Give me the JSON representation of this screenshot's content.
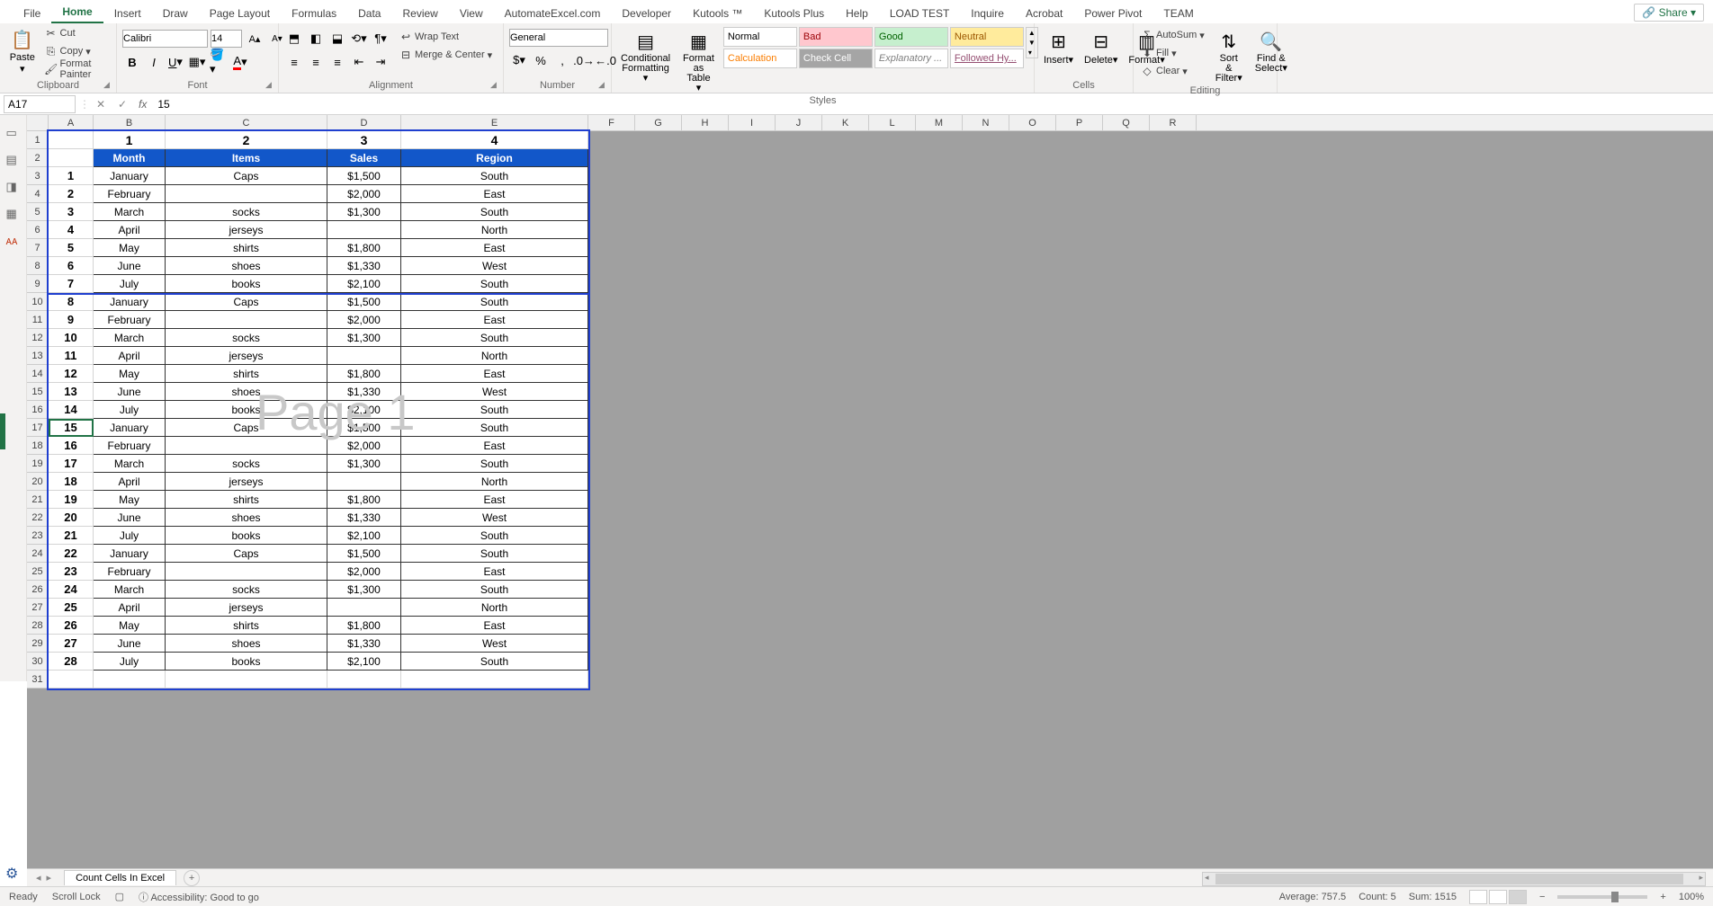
{
  "tabs": [
    "File",
    "Home",
    "Insert",
    "Draw",
    "Page Layout",
    "Formulas",
    "Data",
    "Review",
    "View",
    "AutomateExcel.com",
    "Developer",
    "Kutools ™",
    "Kutools Plus",
    "Help",
    "LOAD TEST",
    "Inquire",
    "Acrobat",
    "Power Pivot",
    "TEAM"
  ],
  "active_tab": "Home",
  "share": "Share",
  "clipboard": {
    "paste": "Paste",
    "cut": "Cut",
    "copy": "Copy",
    "painter": "Format Painter",
    "label": "Clipboard"
  },
  "font": {
    "name": "Calibri",
    "size": "14",
    "label": "Font"
  },
  "alignment": {
    "wrap": "Wrap Text",
    "merge": "Merge & Center",
    "label": "Alignment"
  },
  "number": {
    "format": "General",
    "label": "Number"
  },
  "styles": {
    "cond": "Conditional Formatting",
    "table": "Format as Table",
    "gallery": [
      {
        "t": "Normal",
        "bg": "#ffffff",
        "c": "#000"
      },
      {
        "t": "Bad",
        "bg": "#ffc7ce",
        "c": "#9c0006"
      },
      {
        "t": "Good",
        "bg": "#c6efce",
        "c": "#006100"
      },
      {
        "t": "Neutral",
        "bg": "#ffeb9c",
        "c": "#9c5700"
      },
      {
        "t": "Calculation",
        "bg": "#ffffff",
        "c": "#fa7d00"
      },
      {
        "t": "Check Cell",
        "bg": "#a5a5a5",
        "c": "#ffffff"
      },
      {
        "t": "Explanatory ...",
        "bg": "#ffffff",
        "c": "#7f7f7f",
        "i": true
      },
      {
        "t": "Followed Hy...",
        "bg": "#ffffff",
        "c": "#954f72",
        "u": true
      }
    ],
    "label": "Styles"
  },
  "cells_group": {
    "insert": "Insert",
    "delete": "Delete",
    "format": "Format",
    "label": "Cells"
  },
  "editing": {
    "autosum": "AutoSum",
    "fill": "Fill",
    "clear": "Clear",
    "sort": "Sort & Filter",
    "find": "Find & Select",
    "label": "Editing"
  },
  "name_box": "A17",
  "formula": "15",
  "columns": [
    "A",
    "B",
    "C",
    "D",
    "E",
    "F",
    "G",
    "H",
    "I",
    "J",
    "K",
    "L",
    "M",
    "N",
    "O",
    "P",
    "Q",
    "R"
  ],
  "col_widths": {
    "A": 50,
    "B": 80,
    "C": 180,
    "D": 82,
    "E": 208,
    "other": 52
  },
  "header_nums": [
    "1",
    "2",
    "3",
    "4"
  ],
  "table_headers": [
    "Month",
    "Items",
    "Sales",
    "Region"
  ],
  "rows": [
    {
      "n": "1",
      "m": "January",
      "i": "Caps",
      "s": "$1,500",
      "r": "South"
    },
    {
      "n": "2",
      "m": "February",
      "i": "",
      "s": "$2,000",
      "r": "East"
    },
    {
      "n": "3",
      "m": "March",
      "i": "socks",
      "s": "$1,300",
      "r": "South"
    },
    {
      "n": "4",
      "m": "April",
      "i": "jerseys",
      "s": "",
      "r": "North"
    },
    {
      "n": "5",
      "m": "May",
      "i": "shirts",
      "s": "$1,800",
      "r": "East"
    },
    {
      "n": "6",
      "m": "June",
      "i": "shoes",
      "s": "$1,330",
      "r": "West"
    },
    {
      "n": "7",
      "m": "July",
      "i": "books",
      "s": "$2,100",
      "r": "South"
    },
    {
      "n": "8",
      "m": "January",
      "i": "Caps",
      "s": "$1,500",
      "r": "South"
    },
    {
      "n": "9",
      "m": "February",
      "i": "",
      "s": "$2,000",
      "r": "East"
    },
    {
      "n": "10",
      "m": "March",
      "i": "socks",
      "s": "$1,300",
      "r": "South"
    },
    {
      "n": "11",
      "m": "April",
      "i": "jerseys",
      "s": "",
      "r": "North"
    },
    {
      "n": "12",
      "m": "May",
      "i": "shirts",
      "s": "$1,800",
      "r": "East"
    },
    {
      "n": "13",
      "m": "June",
      "i": "shoes",
      "s": "$1,330",
      "r": "West"
    },
    {
      "n": "14",
      "m": "July",
      "i": "books",
      "s": "$2,100",
      "r": "South"
    },
    {
      "n": "15",
      "m": "January",
      "i": "Caps",
      "s": "$1,500",
      "r": "South"
    },
    {
      "n": "16",
      "m": "February",
      "i": "",
      "s": "$2,000",
      "r": "East"
    },
    {
      "n": "17",
      "m": "March",
      "i": "socks",
      "s": "$1,300",
      "r": "South"
    },
    {
      "n": "18",
      "m": "April",
      "i": "jerseys",
      "s": "",
      "r": "North"
    },
    {
      "n": "19",
      "m": "May",
      "i": "shirts",
      "s": "$1,800",
      "r": "East"
    },
    {
      "n": "20",
      "m": "June",
      "i": "shoes",
      "s": "$1,330",
      "r": "West"
    },
    {
      "n": "21",
      "m": "July",
      "i": "books",
      "s": "$2,100",
      "r": "South"
    },
    {
      "n": "22",
      "m": "January",
      "i": "Caps",
      "s": "$1,500",
      "r": "South"
    },
    {
      "n": "23",
      "m": "February",
      "i": "",
      "s": "$2,000",
      "r": "East"
    },
    {
      "n": "24",
      "m": "March",
      "i": "socks",
      "s": "$1,300",
      "r": "South"
    },
    {
      "n": "25",
      "m": "April",
      "i": "jerseys",
      "s": "",
      "r": "North"
    },
    {
      "n": "26",
      "m": "May",
      "i": "shirts",
      "s": "$1,800",
      "r": "East"
    },
    {
      "n": "27",
      "m": "June",
      "i": "shoes",
      "s": "$1,330",
      "r": "West"
    },
    {
      "n": "28",
      "m": "July",
      "i": "books",
      "s": "$2,100",
      "r": "South"
    }
  ],
  "watermark": "Page 1",
  "sheet_name": "Count Cells In Excel",
  "status": {
    "ready": "Ready",
    "scroll": "Scroll Lock",
    "access": "Accessibility: Good to go",
    "avg": "Average: 757.5",
    "count": "Count: 5",
    "sum": "Sum: 1515",
    "zoom": "100%"
  }
}
